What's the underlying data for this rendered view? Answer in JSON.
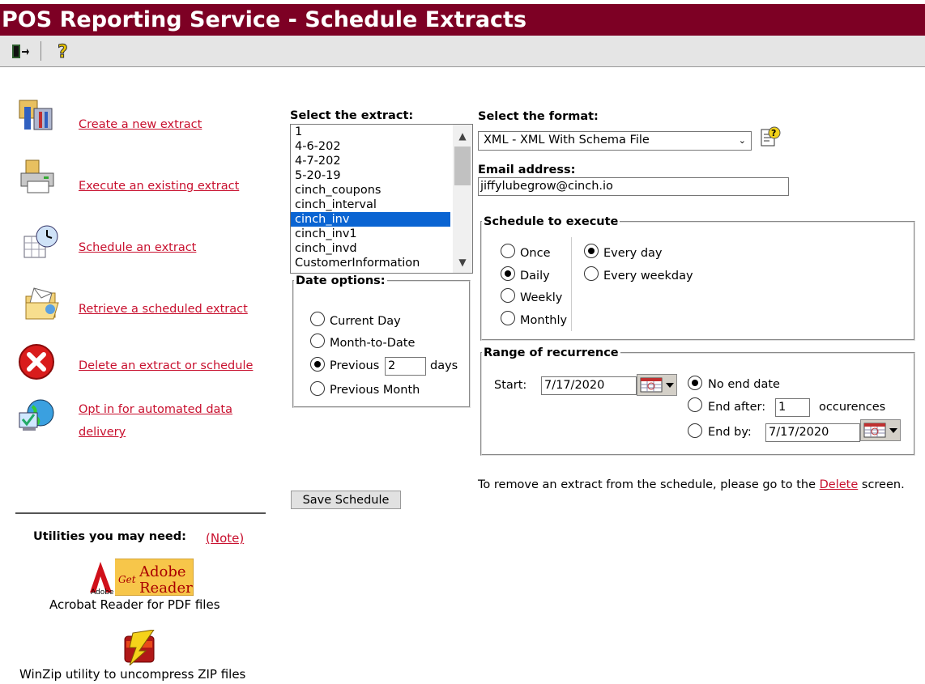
{
  "window": {
    "title": "POS Reporting Service - Schedule Extracts"
  },
  "toolbar": {
    "exit_icon": "exit-door-icon",
    "help_icon": "help-question-icon"
  },
  "nav": {
    "items": [
      {
        "label": "Create a new extract",
        "icon": "new-extract-icon"
      },
      {
        "label": "Execute an existing extract",
        "icon": "printer-icon"
      },
      {
        "label": "Schedule an extract",
        "icon": "clock-calendar-icon"
      },
      {
        "label": "Retrieve a scheduled extract",
        "icon": "folder-mail-icon"
      },
      {
        "label": "Delete an extract or schedule",
        "icon": "delete-x-icon"
      },
      {
        "label_line1": "Opt in for automated data",
        "label_line2": "delivery",
        "icon": "globe-computer-icon"
      }
    ]
  },
  "utilities": {
    "heading": "Utilities you may need:",
    "note_link": "(Note)",
    "adobe_caption": "Acrobat Reader for PDF files",
    "adobe_logo_text": "Get Adobe Reader",
    "winzip_caption": "WinZip utility to uncompress ZIP files"
  },
  "extract": {
    "label": "Select the extract:",
    "options": [
      "1",
      "4-6-202",
      "4-7-202",
      "5-20-19",
      "cinch_coupons",
      "cinch_interval",
      "cinch_inv",
      "cinch_inv1",
      "cinch_invd",
      "CustomerInformation"
    ],
    "selected": "cinch_inv"
  },
  "date_options": {
    "legend": "Date options:",
    "current_day": "Current Day",
    "month_to_date": "Month-to-Date",
    "previous": "Previous",
    "previous_value": "2",
    "days": "days",
    "previous_month": "Previous Month",
    "selected": "Previous"
  },
  "format": {
    "label": "Select the format:",
    "value": "XML - XML With Schema File"
  },
  "email": {
    "label": "Email address:",
    "value": "jiffylubegrow@cinch.io"
  },
  "schedule": {
    "legend": "Schedule to execute",
    "once": "Once",
    "daily": "Daily",
    "weekly": "Weekly",
    "monthly": "Monthly",
    "every_day": "Every day",
    "every_weekday": "Every weekday",
    "selected_freq": "Daily",
    "selected_day": "Every day"
  },
  "recurrence": {
    "legend": "Range of recurrence",
    "start_label": "Start:",
    "start_value": "7/17/2020",
    "no_end": "No end date",
    "end_after": "End after:",
    "end_after_value": "1",
    "occurences": "occurences",
    "end_by": "End by:",
    "end_by_value": "7/17/2020",
    "selected": "No end date"
  },
  "footer_note": {
    "prefix": "To remove an extract from the schedule, please go to the",
    "link": "Delete",
    "suffix": "screen."
  },
  "save_button": "Save Schedule"
}
